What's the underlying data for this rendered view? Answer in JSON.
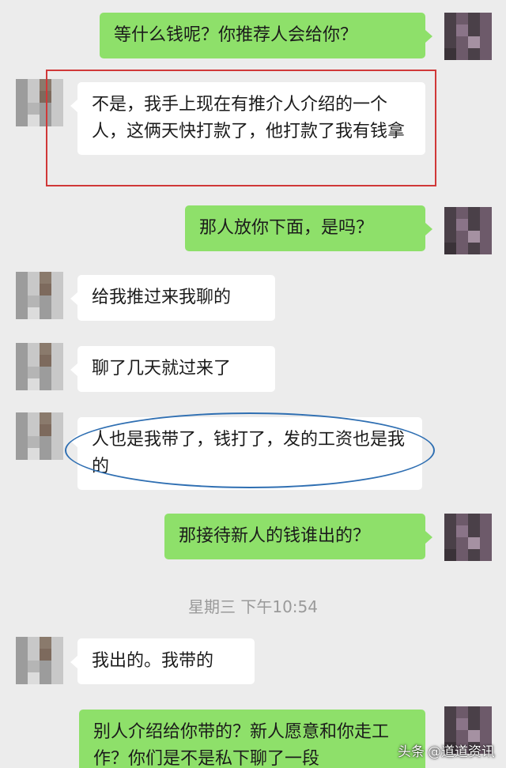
{
  "messages": [
    {
      "side": "out",
      "text": "等什么钱呢？你推荐人会给你？"
    },
    {
      "side": "in",
      "text": "不是，我手上现在有推介人介绍的一个人，这俩天快打款了，他打款了我有钱拿"
    },
    {
      "side": "out",
      "text": "那人放你下面，是吗？"
    },
    {
      "side": "in",
      "text": "给我推过来我聊的"
    },
    {
      "side": "in",
      "text": "聊了几天就过来了"
    },
    {
      "side": "in",
      "text": "人也是我带了，钱打了，发的工资也是我的"
    },
    {
      "side": "out",
      "text": "那接待新人的钱谁出的？"
    },
    {
      "side": "in",
      "text": "我出的。我带的"
    },
    {
      "side": "out",
      "text": "别人介绍给你带的？新人愿意和你走工作？你们是不是私下聊了一段"
    }
  ],
  "timestamp": "星期三 下午10:54",
  "watermark": {
    "brand": "头条",
    "handle": "@道道资讯"
  },
  "colors": {
    "background": "#ececec",
    "outgoing_bubble": "#8ee06a",
    "incoming_bubble": "#ffffff",
    "highlight_rect": "#d03838",
    "highlight_ellipse": "#2f6fb2"
  }
}
